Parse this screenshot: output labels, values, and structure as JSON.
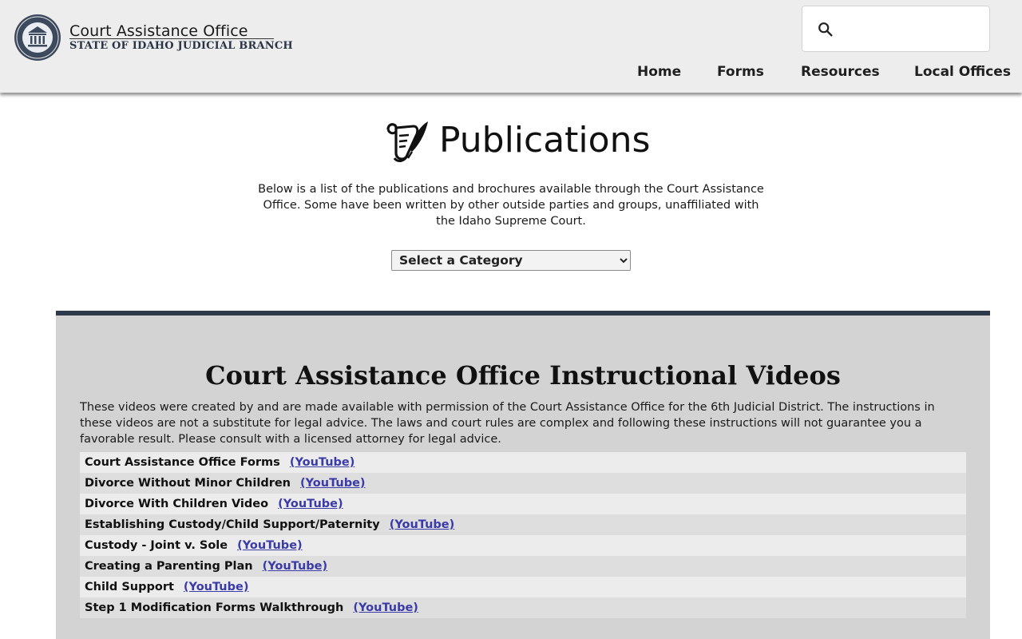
{
  "header": {
    "brand_title": "Court Assistance Office",
    "brand_subtitle": "STATE OF IDAHO JUDICIAL BRANCH",
    "search": {
      "placeholder": "",
      "value": ""
    },
    "nav": [
      {
        "label": "Home"
      },
      {
        "label": "Forms"
      },
      {
        "label": "Resources"
      },
      {
        "label": "Local Offices"
      }
    ]
  },
  "publications": {
    "title": "Publications",
    "description": "Below is a list of the publications and brochures available through the Court Assistance Office. Some have been written by other outside parties and groups, unaffiliated with the Idaho Supreme Court.",
    "category_select": {
      "selected": "Select a Category"
    }
  },
  "videos": {
    "title": "Court Assistance Office Instructional Videos",
    "description": "These videos were created by and are made available with permission of the Court Assistance Office for the 6th Judicial District. The instructions in these videos are not a substitute for legal advice. The laws and court rules are complex and following these instructions will not guarantee you a favorable result. Please consult with a licensed attorney for legal advice.",
    "items": [
      {
        "name": "Court Assistance Office Forms",
        "link": "(YouTube)"
      },
      {
        "name": "Divorce Without Minor Children",
        "link": "(YouTube)"
      },
      {
        "name": "Divorce With Children Video",
        "link": "(YouTube)"
      },
      {
        "name": "Establishing Custody/Child Support/Paternity",
        "link": "(YouTube)"
      },
      {
        "name": "Custody - Joint v. Sole",
        "link": "(YouTube)"
      },
      {
        "name": "Creating a Parenting Plan",
        "link": "(YouTube)"
      },
      {
        "name": "Child Support",
        "link": "(YouTube)"
      },
      {
        "name": "Step 1 Modification Forms Walkthrough",
        "link": "(YouTube)"
      }
    ]
  },
  "icons": {
    "seal": "court-seal-icon",
    "search": "search-icon",
    "publications": "scroll-quill-icon"
  },
  "colors": {
    "header_bg": "#ededed",
    "panel_bg": "#d3d3d3",
    "panel_border": "#2f3b4c",
    "link": "#3a3aa8"
  }
}
